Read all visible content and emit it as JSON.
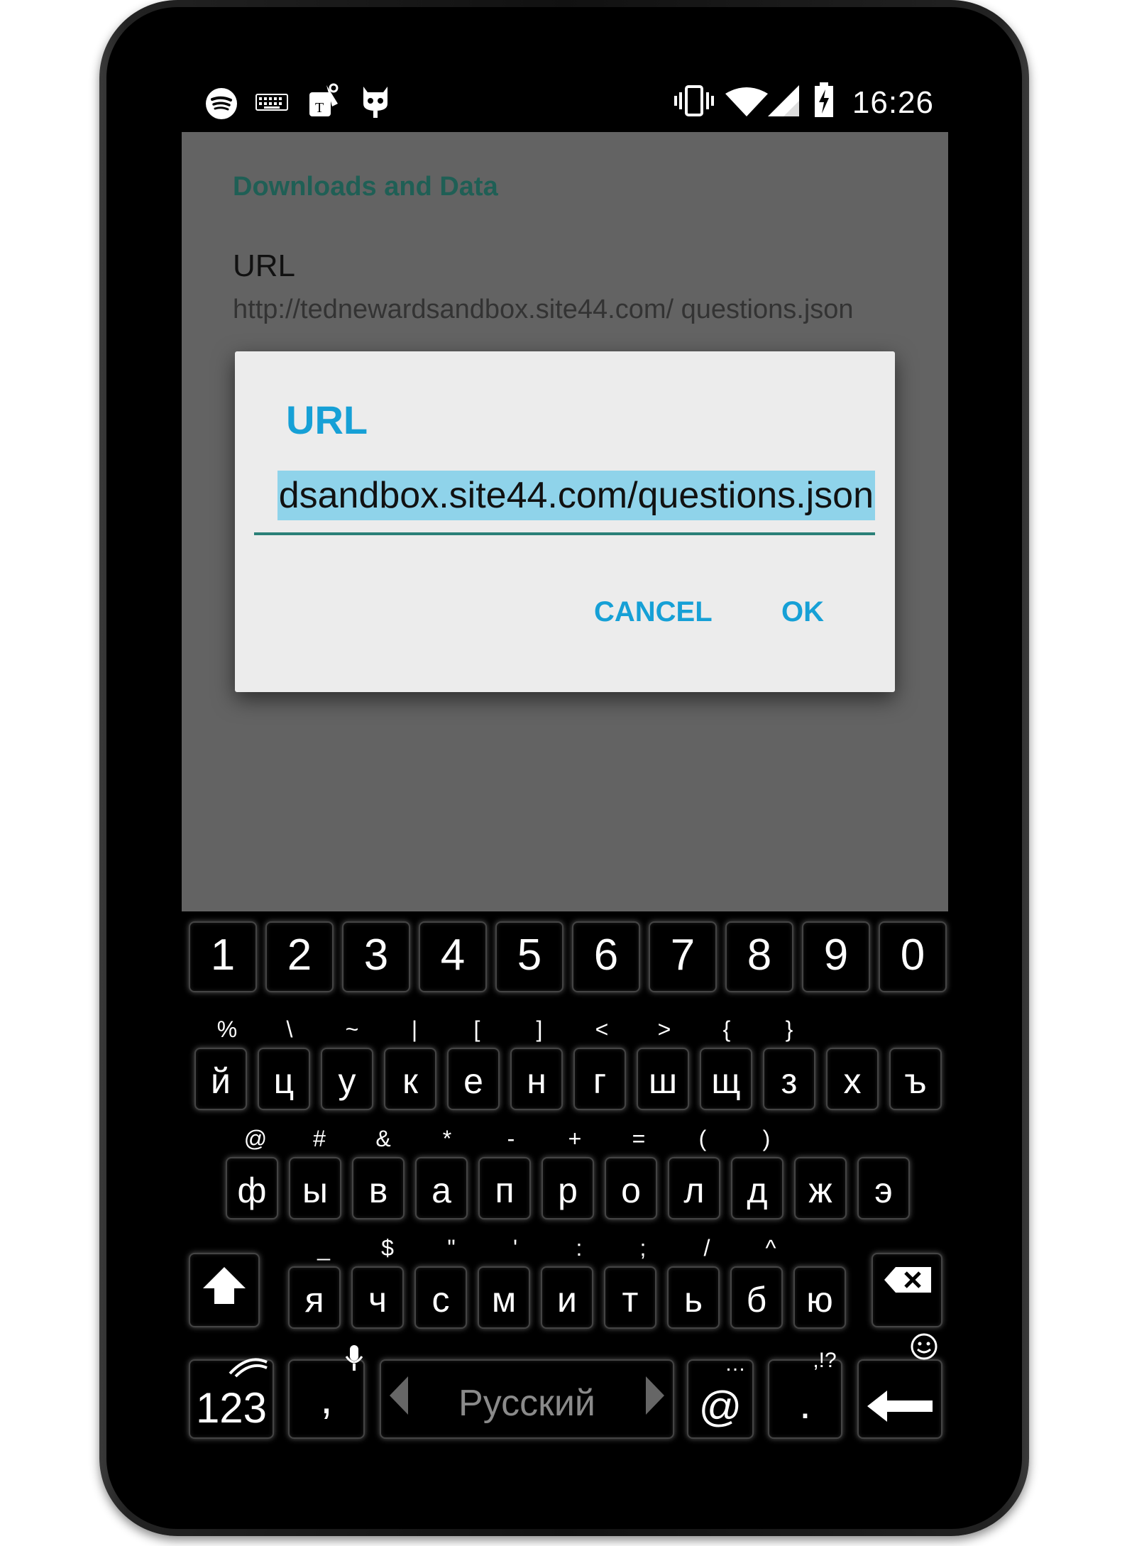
{
  "status_bar": {
    "time": "16:26",
    "left_icons": [
      "spotify-icon",
      "keyboard-icon",
      "tmobile-icon",
      "cyanogen-icon"
    ],
    "right_icons": [
      "vibrate-icon",
      "wifi-icon",
      "signal-icon",
      "battery-charging-icon"
    ]
  },
  "screen": {
    "category": "Downloads and Data",
    "pref_title": "URL",
    "pref_summary": "http://tednewardsandbox.site44.com/ questions.json"
  },
  "dialog": {
    "title": "URL",
    "input_value": "dsandbox.site44.com/questions.json",
    "cancel_label": "CANCEL",
    "ok_label": "OK"
  },
  "keyboard": {
    "number_row": [
      "1",
      "2",
      "3",
      "4",
      "5",
      "6",
      "7",
      "8",
      "9",
      "0"
    ],
    "row1_hints": [
      "%",
      "\\",
      "~",
      "|",
      "[",
      "]",
      "<",
      ">",
      "{",
      "}"
    ],
    "row1": [
      "й",
      "ц",
      "у",
      "к",
      "е",
      "н",
      "г",
      "ш",
      "щ",
      "з",
      "х",
      "ъ"
    ],
    "row2_hints": [
      "@",
      "#",
      "&",
      "*",
      "-",
      "+",
      "=",
      "(",
      ")"
    ],
    "row2": [
      "ф",
      "ы",
      "в",
      "а",
      "п",
      "р",
      "о",
      "л",
      "д",
      "ж",
      "э"
    ],
    "row3_hints": [
      "_",
      "$",
      "\"",
      "'",
      ":",
      ";",
      "/",
      "^"
    ],
    "row3": [
      "я",
      "ч",
      "с",
      "м",
      "и",
      "т",
      "ь",
      "б",
      "ю"
    ],
    "mode_label": "123",
    "comma_label": ",",
    "language_label": "Русский",
    "at_label": "@",
    "at_hint": "…",
    "period_label": ".",
    "period_hint": ",!?",
    "colors": {
      "accent": "#16a0d6",
      "selection": "#8fd3ea",
      "underline": "#2b8078",
      "dim_overlay": "#636363"
    }
  }
}
